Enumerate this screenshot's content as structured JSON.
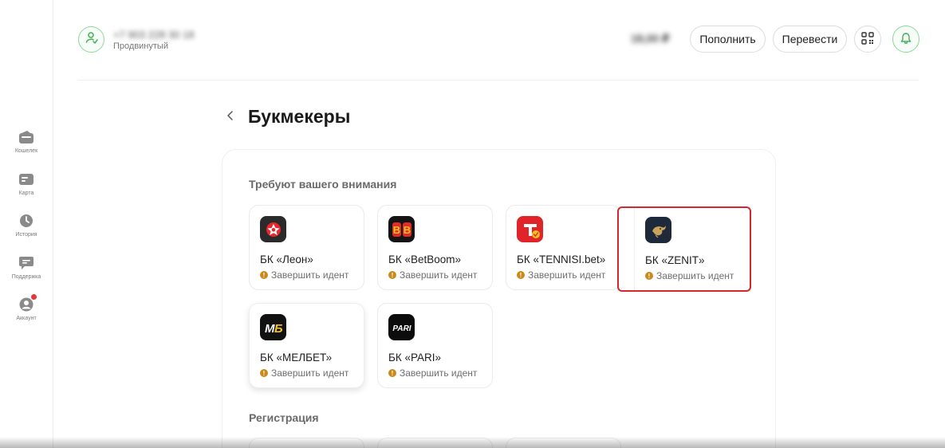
{
  "sidebar": {
    "items": [
      {
        "label": "Кошелек",
        "icon": "wallet-icon"
      },
      {
        "label": "Карта",
        "icon": "card-icon"
      },
      {
        "label": "История",
        "icon": "clock-icon"
      },
      {
        "label": "Поддержка",
        "icon": "chat-icon"
      },
      {
        "label": "Аккаунт",
        "icon": "account-icon",
        "has_badge": true
      }
    ]
  },
  "header": {
    "phone": "+7 903 228 30 18",
    "status": "Продвинутый",
    "balance": "18,00 ₽",
    "topup_label": "Пополнить",
    "transfer_label": "Перевести"
  },
  "page": {
    "title": "Букмекеры"
  },
  "sections": {
    "attention_title": "Требуют вашего внимания",
    "registration_title": "Регистрация"
  },
  "bookmakers": [
    {
      "name": "БК «Леон»",
      "status": "Завершить идент",
      "logo_bg": "#2b2b2b"
    },
    {
      "name": "БК «BetBoom»",
      "status": "Завершить идент",
      "logo_bg": "#141414"
    },
    {
      "name": "БК «TENNISI.bet»",
      "status": "Завершить идент",
      "logo_bg": "#e1232a"
    },
    {
      "name": "БК «ZENIT»",
      "status": "Завершить идент",
      "logo_bg": "#1e2a3a"
    },
    {
      "name": "БК «МЕЛБЕТ»",
      "status": "Завершить идент",
      "logo_bg": "#111111"
    },
    {
      "name": "БК «PARI»",
      "status": "Завершить идент",
      "logo_bg": "#0c0c0c"
    }
  ],
  "colors": {
    "accent_green": "#3fb154",
    "selected_border": "#d7262d",
    "warning": "#c98a1a"
  }
}
